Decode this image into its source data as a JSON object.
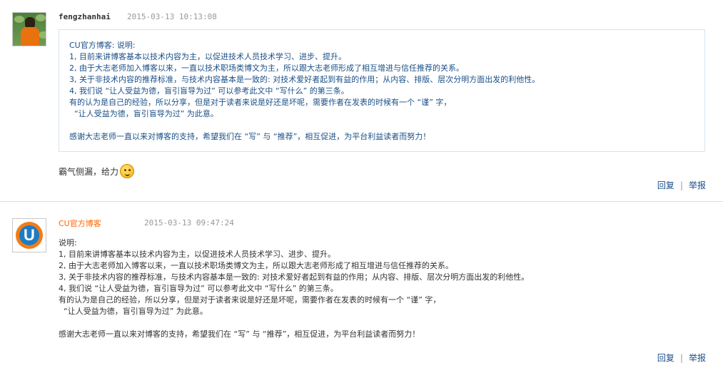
{
  "comments": [
    {
      "user": "fengzhanhai",
      "time": "2015-03-13 10:13:08",
      "quote_lines": [
        "CU官方博客: 说明:",
        "1, 目前来讲博客基本以技术内容为主，以促进技术人员技术学习、进步、提升。",
        "2, 由于大志老师加入博客以来，一直以技术职场类博文为主，所以跟大志老师形成了相互增进与信任推荐的关系。",
        "3, 关于非技术内容的推荐标准，与技术内容基本是一致的: 对技术爱好者起到有益的作用；从内容、排版、层次分明方面出发的利他性。",
        "4, 我们说 “让人受益为德，盲引盲导为过” 可以参考此文中 “写什么” 的第三条。",
        "有的认为是自己的经验，所以分享，但是对于读者来说是好还是坏呢，需要作者在发表的时候有一个 “谨” 字，",
        "  “让人受益为德，盲引盲导为过” 为此意。",
        "",
        "感谢大志老师一直以来对博客的支持，希望我们在 “写” 与 “推荐”，相互促进，为平台利益读者而努力！"
      ],
      "reply_text": "霸气侧漏，给力",
      "reply_label": "回复",
      "report_label": "举报"
    },
    {
      "user": "CU官方博客",
      "time": "2015-03-13 09:47:24",
      "body_lines": [
        "说明:",
        "1, 目前来讲博客基本以技术内容为主，以促进技术人员技术学习、进步、提升。",
        "2, 由于大志老师加入博客以来，一直以技术职场类博文为主，所以跟大志老师形成了相互增进与信任推荐的关系。",
        "3, 关于非技术内容的推荐标准，与技术内容基本是一致的: 对技术爱好者起到有益的作用；从内容、排版、层次分明方面出发的利他性。",
        "4, 我们说 “让人受益为德，盲引盲导为过” 可以参考此文中 “写什么” 的第三条。",
        "有的认为是自己的经验，所以分享，但是对于读者来说是好还是坏呢，需要作者在发表的时候有一个 “谨” 字，",
        "  “让人受益为德，盲引盲导为过” 为此意。",
        "",
        "感谢大志老师一直以来对博客的支持，希望我们在 “写” 与 “推荐”，相互促进，为平台利益读者而努力！"
      ],
      "reply_label": "回复",
      "report_label": "举报"
    }
  ],
  "colors": {
    "username_link": "#ff6600",
    "quote_text": "#1a4f87",
    "link": "#1a4f87"
  },
  "icons": {
    "reply_emoji": "thinking-emoji-icon"
  }
}
